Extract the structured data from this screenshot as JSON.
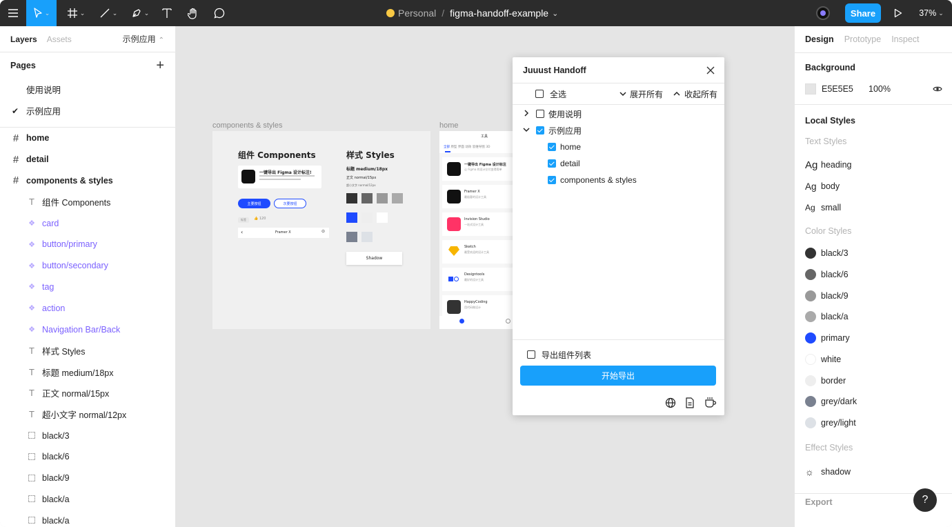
{
  "toolbar": {
    "workspace": "Personal",
    "file_name": "figma-handoff-example",
    "share_label": "Share",
    "zoom": "37%"
  },
  "left_panel": {
    "tab_layers": "Layers",
    "tab_assets": "Assets",
    "current_page": "示例应用",
    "pages_title": "Pages",
    "pages": [
      {
        "label": "使用说明",
        "selected": false
      },
      {
        "label": "示例应用",
        "selected": true
      }
    ],
    "layers": [
      {
        "label": "home",
        "kind": "frame"
      },
      {
        "label": "detail",
        "kind": "frame"
      },
      {
        "label": "components & styles",
        "kind": "frame"
      },
      {
        "label": "组件 Components",
        "kind": "text"
      },
      {
        "label": "card",
        "kind": "component"
      },
      {
        "label": "button/primary",
        "kind": "component"
      },
      {
        "label": "button/secondary",
        "kind": "component"
      },
      {
        "label": "tag",
        "kind": "component"
      },
      {
        "label": "action",
        "kind": "component"
      },
      {
        "label": "Navigation Bar/Back",
        "kind": "component"
      },
      {
        "label": "样式 Styles",
        "kind": "text"
      },
      {
        "label": "标题 medium/18px",
        "kind": "text"
      },
      {
        "label": "正文 normal/15px",
        "kind": "text"
      },
      {
        "label": "超小文字 normal/12px",
        "kind": "text"
      },
      {
        "label": "black/3",
        "kind": "rect"
      },
      {
        "label": "black/6",
        "kind": "rect"
      },
      {
        "label": "black/9",
        "kind": "rect"
      },
      {
        "label": "black/a",
        "kind": "rect"
      },
      {
        "label": "black/a",
        "kind": "rect"
      }
    ]
  },
  "canvas": {
    "frame1_label": "components & styles",
    "frame2_label": "home",
    "components_title": "组件 Components",
    "styles_title": "样式 Styles",
    "style_heading_sample": "标题 medium/18px",
    "style_body_sample": "正文 normal/15px",
    "style_small_sample": "超小文字 normal/12px",
    "card_title": "一键导出 Figma 设计标注!",
    "btn_primary": "主要按钮",
    "btn_secondary": "次要按钮",
    "tag_label": "标签",
    "like_count": "120",
    "nav_title": "Framer X",
    "shadow_label": "Shadow",
    "home_title": "工具",
    "home_tabs": [
      "全部",
      "原型",
      "界面",
      "动效",
      "思维导图",
      "3D"
    ],
    "home_items": [
      {
        "title": "一键导出 Figma 设计标注",
        "desc": "让 Figma 的设计交付变得简单"
      },
      {
        "title": "Framer X",
        "desc": "最极客的设计工具"
      },
      {
        "title": "Invision Studio",
        "desc": "一站式设计工具"
      },
      {
        "title": "Sketch",
        "desc": "最受欢迎的设计工具"
      },
      {
        "title": "Designtools",
        "desc": "最好的设计工具"
      },
      {
        "title": "HappyCoding",
        "desc": "用代码做设计"
      }
    ]
  },
  "dialog": {
    "title": "Juuust Handoff",
    "select_all": "全选",
    "expand_all": "展开所有",
    "collapse_all": "收起所有",
    "pages": [
      {
        "label": "使用说明",
        "checked": false,
        "expanded": false
      },
      {
        "label": "示例应用",
        "checked": true,
        "expanded": true
      }
    ],
    "frames": [
      {
        "label": "home",
        "checked": true
      },
      {
        "label": "detail",
        "checked": true
      },
      {
        "label": "components & styles",
        "checked": true
      }
    ],
    "export_list_label": "导出组件列表",
    "export_list_checked": false,
    "start_export": "开始导出"
  },
  "right_panel": {
    "tabs": [
      "Design",
      "Prototype",
      "Inspect"
    ],
    "background_title": "Background",
    "bg_hex": "E5E5E5",
    "bg_opacity": "100%",
    "local_styles_title": "Local Styles",
    "text_styles_title": "Text Styles",
    "text_styles": [
      {
        "label": "heading",
        "size": "large"
      },
      {
        "label": "body",
        "size": "medium"
      },
      {
        "label": "small",
        "size": "small"
      }
    ],
    "color_styles_title": "Color Styles",
    "color_styles": [
      {
        "label": "black/3",
        "color": "#333333"
      },
      {
        "label": "black/6",
        "color": "#666666"
      },
      {
        "label": "black/9",
        "color": "#999999"
      },
      {
        "label": "black/a",
        "color": "#aaaaaa"
      },
      {
        "label": "primary",
        "color": "#1f4bff"
      },
      {
        "label": "white",
        "color": "#ffffff"
      },
      {
        "label": "border",
        "color": "#eeeeee"
      },
      {
        "label": "grey/dark",
        "color": "#7a8190"
      },
      {
        "label": "grey/light",
        "color": "#dde1e6"
      }
    ],
    "effect_styles_title": "Effect Styles",
    "effect_styles": [
      {
        "label": "shadow"
      }
    ],
    "export_title": "Export"
  },
  "help_label": "?"
}
